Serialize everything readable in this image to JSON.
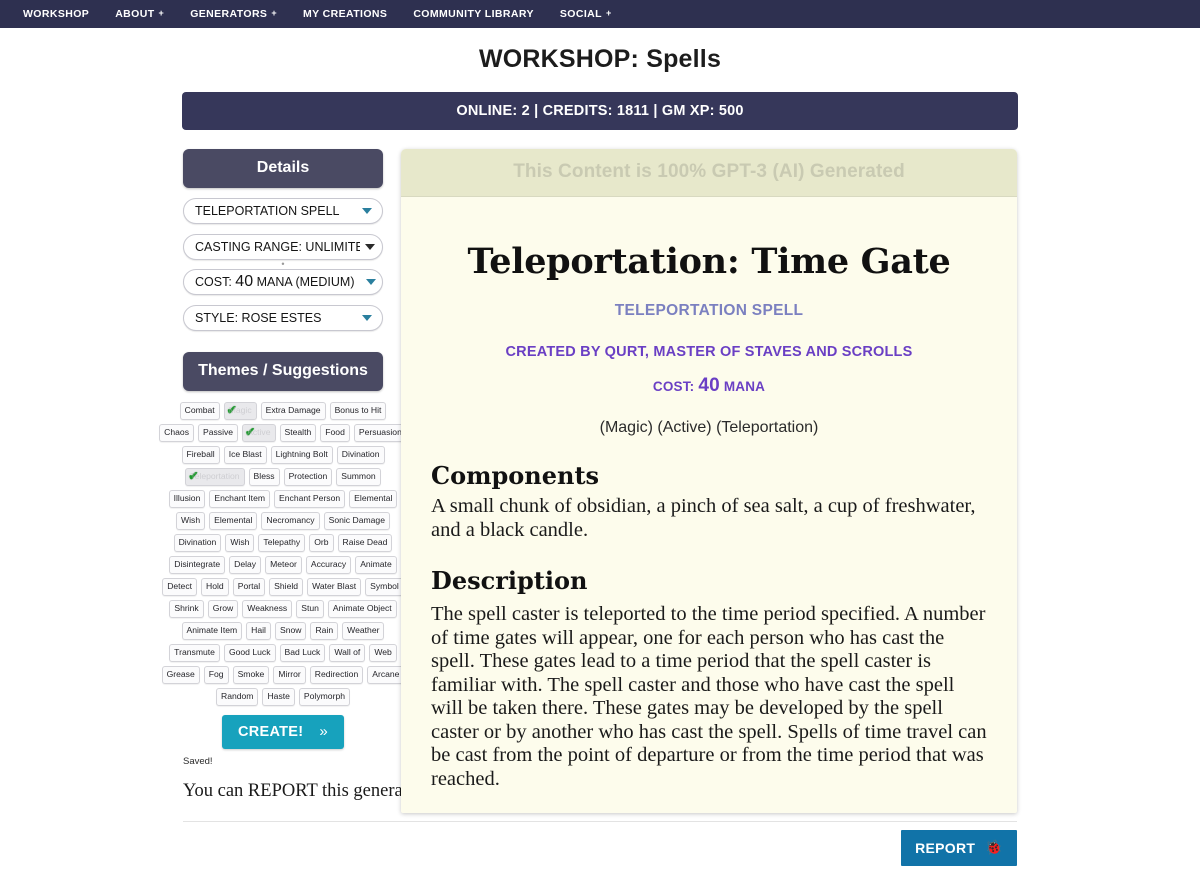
{
  "nav": {
    "items": [
      {
        "label": "WORKSHOP",
        "caret": false
      },
      {
        "label": "ABOUT",
        "caret": true
      },
      {
        "label": "GENERATORS",
        "caret": true
      },
      {
        "label": "MY CREATIONS",
        "caret": false
      },
      {
        "label": "COMMUNITY LIBRARY",
        "caret": false
      },
      {
        "label": "SOCIAL",
        "caret": true
      }
    ],
    "caret_glyph": "+"
  },
  "page": {
    "title": "WORKSHOP: Spells",
    "status": "ONLINE: 2 | CREDITS: 1811 | GM XP: 500"
  },
  "sidebar": {
    "details_header": "Details",
    "themes_header": "Themes / Suggestions",
    "selects": [
      {
        "label": "TELEPORTATION SPELL",
        "name": "spell-type-select"
      },
      {
        "label": "CASTING RANGE: UNLIMITED",
        "name": "casting-range-select"
      },
      {
        "label": "COST: ",
        "value": "40",
        "suffix": " MANA (MEDIUM)",
        "name": "cost-select"
      },
      {
        "label": "STYLE: ROSE ESTES",
        "name": "style-select"
      }
    ],
    "dot_separator": "•",
    "create_label": "CREATE!",
    "create_chevron": "»",
    "saved_text": "Saved!",
    "report_note": "You can REPORT this generation for quality or other issues",
    "check_glyph": "✔",
    "tag_rows": [
      [
        {
          "label": "Combat",
          "checked": false
        },
        {
          "label": "Magic",
          "checked": true
        },
        {
          "label": "Extra Damage",
          "checked": false
        },
        {
          "label": "Bonus to Hit",
          "checked": false
        }
      ],
      [
        {
          "label": "Chaos",
          "checked": false
        },
        {
          "label": "Passive",
          "checked": false
        },
        {
          "label": "Active",
          "checked": true
        },
        {
          "label": "Stealth",
          "checked": false
        },
        {
          "label": "Food",
          "checked": false
        },
        {
          "label": "Persuasion",
          "checked": false
        }
      ],
      [
        {
          "label": "Fireball",
          "checked": false
        },
        {
          "label": "Ice Blast",
          "checked": false
        },
        {
          "label": "Lightning Bolt",
          "checked": false
        },
        {
          "label": "Divination",
          "checked": false
        }
      ],
      [
        {
          "label": "Teleportation",
          "checked": true
        },
        {
          "label": "Bless",
          "checked": false
        },
        {
          "label": "Protection",
          "checked": false
        },
        {
          "label": "Summon",
          "checked": false
        }
      ],
      [
        {
          "label": "Illusion",
          "checked": false
        },
        {
          "label": "Enchant Item",
          "checked": false
        },
        {
          "label": "Enchant Person",
          "checked": false
        },
        {
          "label": "Elemental",
          "checked": false
        }
      ],
      [
        {
          "label": "Wish",
          "checked": false
        },
        {
          "label": "Elemental",
          "checked": false
        },
        {
          "label": "Necromancy",
          "checked": false
        },
        {
          "label": "Sonic Damage",
          "checked": false
        }
      ],
      [
        {
          "label": "Divination",
          "checked": false
        },
        {
          "label": "Wish",
          "checked": false
        },
        {
          "label": "Telepathy",
          "checked": false
        },
        {
          "label": "Orb",
          "checked": false
        },
        {
          "label": "Raise Dead",
          "checked": false
        }
      ],
      [
        {
          "label": "Disintegrate",
          "checked": false
        },
        {
          "label": "Delay",
          "checked": false
        },
        {
          "label": "Meteor",
          "checked": false
        },
        {
          "label": "Accuracy",
          "checked": false
        },
        {
          "label": "Animate",
          "checked": false
        }
      ],
      [
        {
          "label": "Detect",
          "checked": false
        },
        {
          "label": "Hold",
          "checked": false
        },
        {
          "label": "Portal",
          "checked": false
        },
        {
          "label": "Shield",
          "checked": false
        },
        {
          "label": "Water Blast",
          "checked": false
        },
        {
          "label": "Symbol",
          "checked": false
        }
      ],
      [
        {
          "label": "Shrink",
          "checked": false
        },
        {
          "label": "Grow",
          "checked": false
        },
        {
          "label": "Weakness",
          "checked": false
        },
        {
          "label": "Stun",
          "checked": false
        },
        {
          "label": "Animate Object",
          "checked": false
        }
      ],
      [
        {
          "label": "Animate Item",
          "checked": false
        },
        {
          "label": "Hail",
          "checked": false
        },
        {
          "label": "Snow",
          "checked": false
        },
        {
          "label": "Rain",
          "checked": false
        },
        {
          "label": "Weather",
          "checked": false
        }
      ],
      [
        {
          "label": "Transmute",
          "checked": false
        },
        {
          "label": "Good Luck",
          "checked": false
        },
        {
          "label": "Bad Luck",
          "checked": false
        },
        {
          "label": "Wall of",
          "checked": false
        },
        {
          "label": "Web",
          "checked": false
        }
      ],
      [
        {
          "label": "Grease",
          "checked": false
        },
        {
          "label": "Fog",
          "checked": false
        },
        {
          "label": "Smoke",
          "checked": false
        },
        {
          "label": "Mirror",
          "checked": false
        },
        {
          "label": "Redirection",
          "checked": false
        },
        {
          "label": "Arcane",
          "checked": false
        }
      ],
      [
        {
          "label": "Random",
          "checked": false
        },
        {
          "label": "Haste",
          "checked": false
        },
        {
          "label": "Polymorph",
          "checked": false
        }
      ]
    ]
  },
  "card": {
    "ai_banner": "This Content is 100% GPT-3 (AI) Generated",
    "title": "Teleportation: Time Gate",
    "subtype": "TELEPORTATION SPELL",
    "creator": "CREATED BY QURT, MASTER OF STAVES AND SCROLLS",
    "cost_label": "COST: ",
    "cost_amount": "40",
    "cost_unit": " MANA",
    "tags_line": "(Magic) (Active) (Teleportation)",
    "components_heading": "Components",
    "components_text": "A small chunk of obsidian, a pinch of sea salt, a cup of freshwater, and a black candle.",
    "description_heading": "Description",
    "description_text": "The spell caster is teleported to the time period specified. A number of time gates will appear, one for each person who has cast the spell. These gates lead to a time period that the spell caster is familiar with. The spell caster and those who have cast the spell will be taken there. These gates may be developed by the spell caster or by another who has cast the spell. Spells of time travel can be cast from the point of departure or from the time period that was reached."
  },
  "footer": {
    "report_label": "REPORT",
    "bug_icon": "🐞"
  },
  "colors": {
    "nav_bg": "#2e3050",
    "status_bg": "#36375a",
    "panel_bg": "#4a4a63",
    "create_bg": "#17a2bd",
    "report_bg": "#1173a8",
    "card_bg": "#fdfcec",
    "banner_bg": "#e7e8cb",
    "accent_purple": "#6a3fc4",
    "subtype_blue": "#7b80c0"
  }
}
